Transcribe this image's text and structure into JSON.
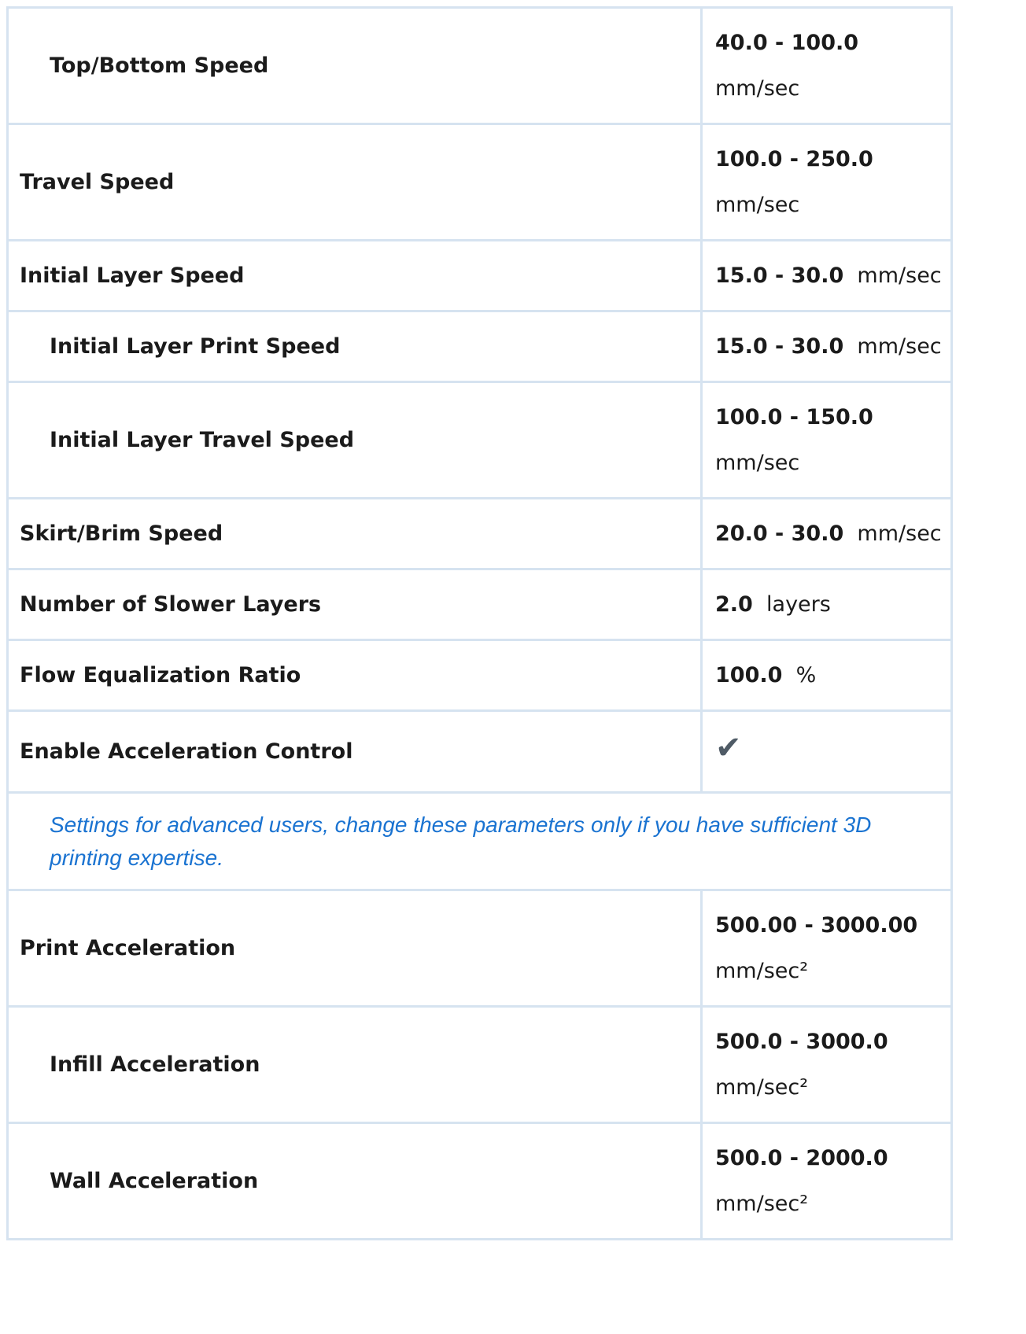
{
  "rows": [
    {
      "name": "Top/Bottom Speed",
      "range": "40.0 - 100.0",
      "unit": "mm/sec"
    },
    {
      "name": "Travel Speed",
      "range": "100.0 - 250.0",
      "unit": "mm/sec"
    },
    {
      "name": "Initial Layer Speed",
      "range": "15.0 - 30.0",
      "unit": "mm/sec"
    },
    {
      "name": "Initial Layer Print Speed",
      "range": "15.0 - 30.0",
      "unit": "mm/sec"
    },
    {
      "name": "Initial Layer Travel Speed",
      "range": "100.0 - 150.0",
      "unit": "mm/sec"
    },
    {
      "name": "Skirt/Brim Speed",
      "range": "20.0 - 30.0",
      "unit": "mm/sec"
    },
    {
      "name": "Number of Slower Layers",
      "range": "2.0",
      "unit": "layers"
    },
    {
      "name": "Flow Equalization Ratio",
      "range": "100.0",
      "unit": "%"
    },
    {
      "name": "Enable Acceleration Control",
      "check": "✔"
    },
    {
      "name": "Print Acceleration",
      "range": "500.00 - 3000.00",
      "unit": "mm/sec²"
    },
    {
      "name": "Infill Acceleration",
      "range": "500.0 - 3000.0",
      "unit": "mm/sec²"
    },
    {
      "name": "Wall Acceleration",
      "range": "500.0 - 2000.0",
      "unit": "mm/sec²"
    }
  ],
  "note": "Settings for advanced users, change these parameters only if you have sufficient 3D printing expertise."
}
